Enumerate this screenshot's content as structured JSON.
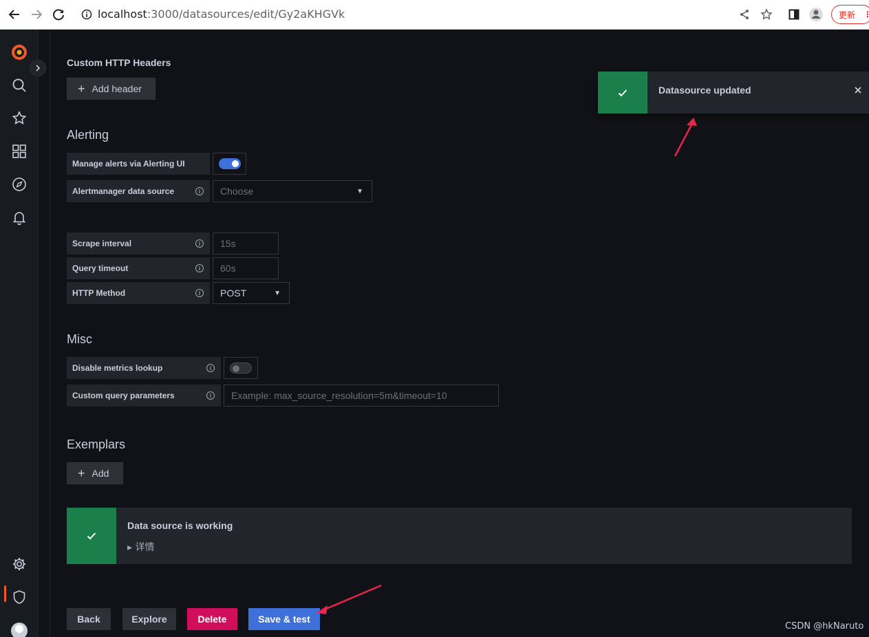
{
  "browser": {
    "url_host": "localhost",
    "url_path": ":3000/datasources/edit/Gy2aKHGVk",
    "update_label": "更新",
    "menu_glyph": "⋮"
  },
  "http": {
    "title": "Custom HTTP Headers",
    "add_header_label": "Add header"
  },
  "alerting": {
    "title": "Alerting",
    "manage_label": "Manage alerts via Alerting UI",
    "manage_enabled": true,
    "am_label": "Alertmanager data source",
    "am_placeholder": "Choose"
  },
  "prom": {
    "scrape_label": "Scrape interval",
    "scrape_placeholder": "15s",
    "timeout_label": "Query timeout",
    "timeout_placeholder": "60s",
    "method_label": "HTTP Method",
    "method_value": "POST"
  },
  "misc": {
    "title": "Misc",
    "disable_label": "Disable metrics lookup",
    "disable_enabled": false,
    "params_label": "Custom query parameters",
    "params_placeholder": "Example: max_source_resolution=5m&timeout=10"
  },
  "exemplars": {
    "title": "Exemplars",
    "add_label": "Add"
  },
  "status": {
    "title": "Data source is working",
    "details": "▸ 详情"
  },
  "toast": {
    "message": "Datasource updated"
  },
  "actions": {
    "back": "Back",
    "explore": "Explore",
    "delete": "Delete",
    "save": "Save & test"
  },
  "watermark": "CSDN @hkNaruto",
  "colors": {
    "success": "#1a7f4b",
    "primary": "#3d71d9",
    "destructive": "#d10e5c",
    "annotation_arrow": "#e8254a",
    "grafana_orange": "#f05a28"
  }
}
